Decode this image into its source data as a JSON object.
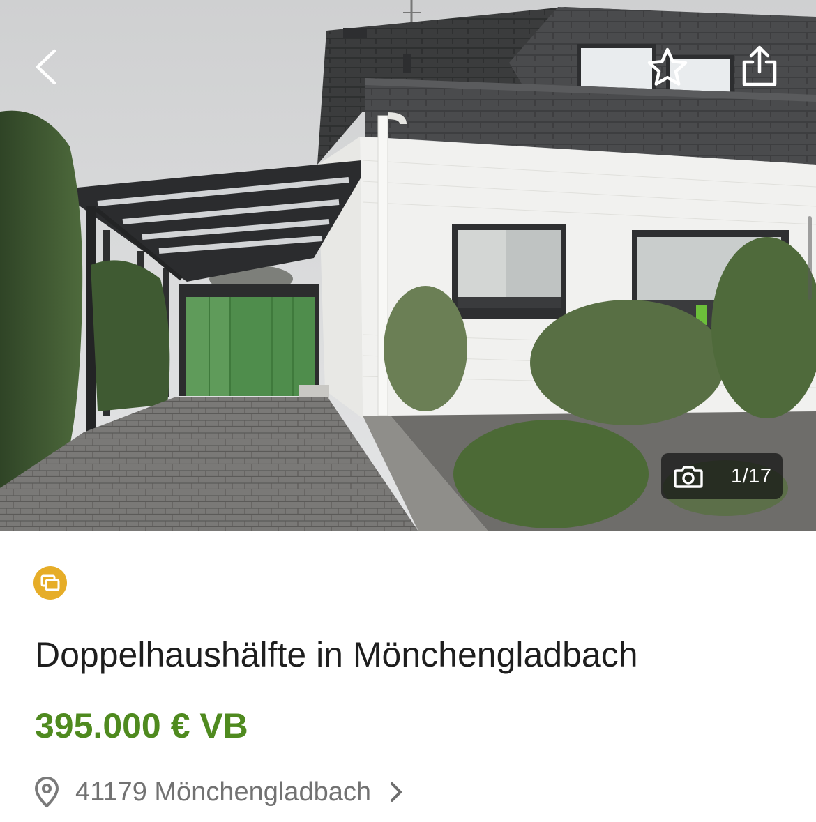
{
  "header": {
    "back_icon": "chevron-left-icon",
    "favorite_icon": "star-outline-icon",
    "share_icon": "share-icon"
  },
  "gallery": {
    "counter_text": "1/17",
    "camera_icon": "camera-icon",
    "current_index": 1,
    "total": 17
  },
  "listing": {
    "badge_icon": "gallery-badge-icon",
    "badge_color": "#e6ad28",
    "title": "Doppelhaushälfte in Mönchengladbach",
    "price": "395.000 € VB",
    "price_color": "#4f8a1f",
    "location": "41179 Mönchengladbach",
    "location_icon": "map-pin-icon"
  }
}
